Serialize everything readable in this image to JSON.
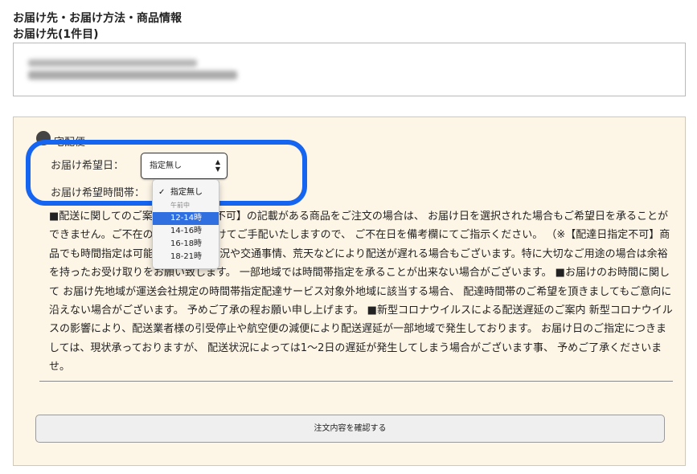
{
  "section": {
    "title": "お届け先・お届け方法・商品情報",
    "subtitle": "お届け先(1件目)"
  },
  "delivery": {
    "method_label": "宅配便",
    "date_label": "お届け希望日：",
    "date_selected": "指定無し",
    "time_label": "お届け希望時間帯：",
    "time_options": [
      {
        "label": "指定無し",
        "selected": true
      },
      {
        "label": "午前中"
      },
      {
        "label": "12-14時",
        "highlighted": true
      },
      {
        "label": "14-16時"
      },
      {
        "label": "16-18時"
      },
      {
        "label": "18-21時"
      }
    ],
    "notice": "■配送に関してのご案内【日付指定不可】の記載がある商品をご注文の場合は、 お届け日を選択された場合もご希望日を承ることができません。ご不在のお日にちは避けてご手配いたしますので、 ご不在日を備考欄にてご指示ください。 （※【配達日指定不可】商品でも時間指定は可能です） 在庫状況や交通事情、荒天などにより配送が遅れる場合もございます。特に大切なご用途の場合は余裕を持ったお受け取りをお願い致します。 一部地域では時間帯指定を承ることが出来ない場合がございます。 ■お届けのお時間に関して お届け先地域が運送会社規定の時間帯指定配達サービス対象外地域に該当する場合、 配達時間帯のご希望を頂きましてもご意向に沿えない場合がございます。 予めご了承の程お願い申し上げます。 ■新型コロナウイルスによる配送遅延のご案内 新型コロナウイルスの影響により、配送業者様の引受停止や航空便の減便により配送遅延が一部地域で発生しております。 お届け日のご指定につきましては、現状承っておりますが、 配送状況によっては1〜2日の遅延が発生してしまう場合がございます事、 予めご了承くださいませ。"
  },
  "actions": {
    "confirm_label": "注文内容を確認する"
  },
  "colors": {
    "panel_bg": "#fdf5e6",
    "highlight_ring": "#1565f0",
    "option_highlight": "#2f6fe0"
  }
}
